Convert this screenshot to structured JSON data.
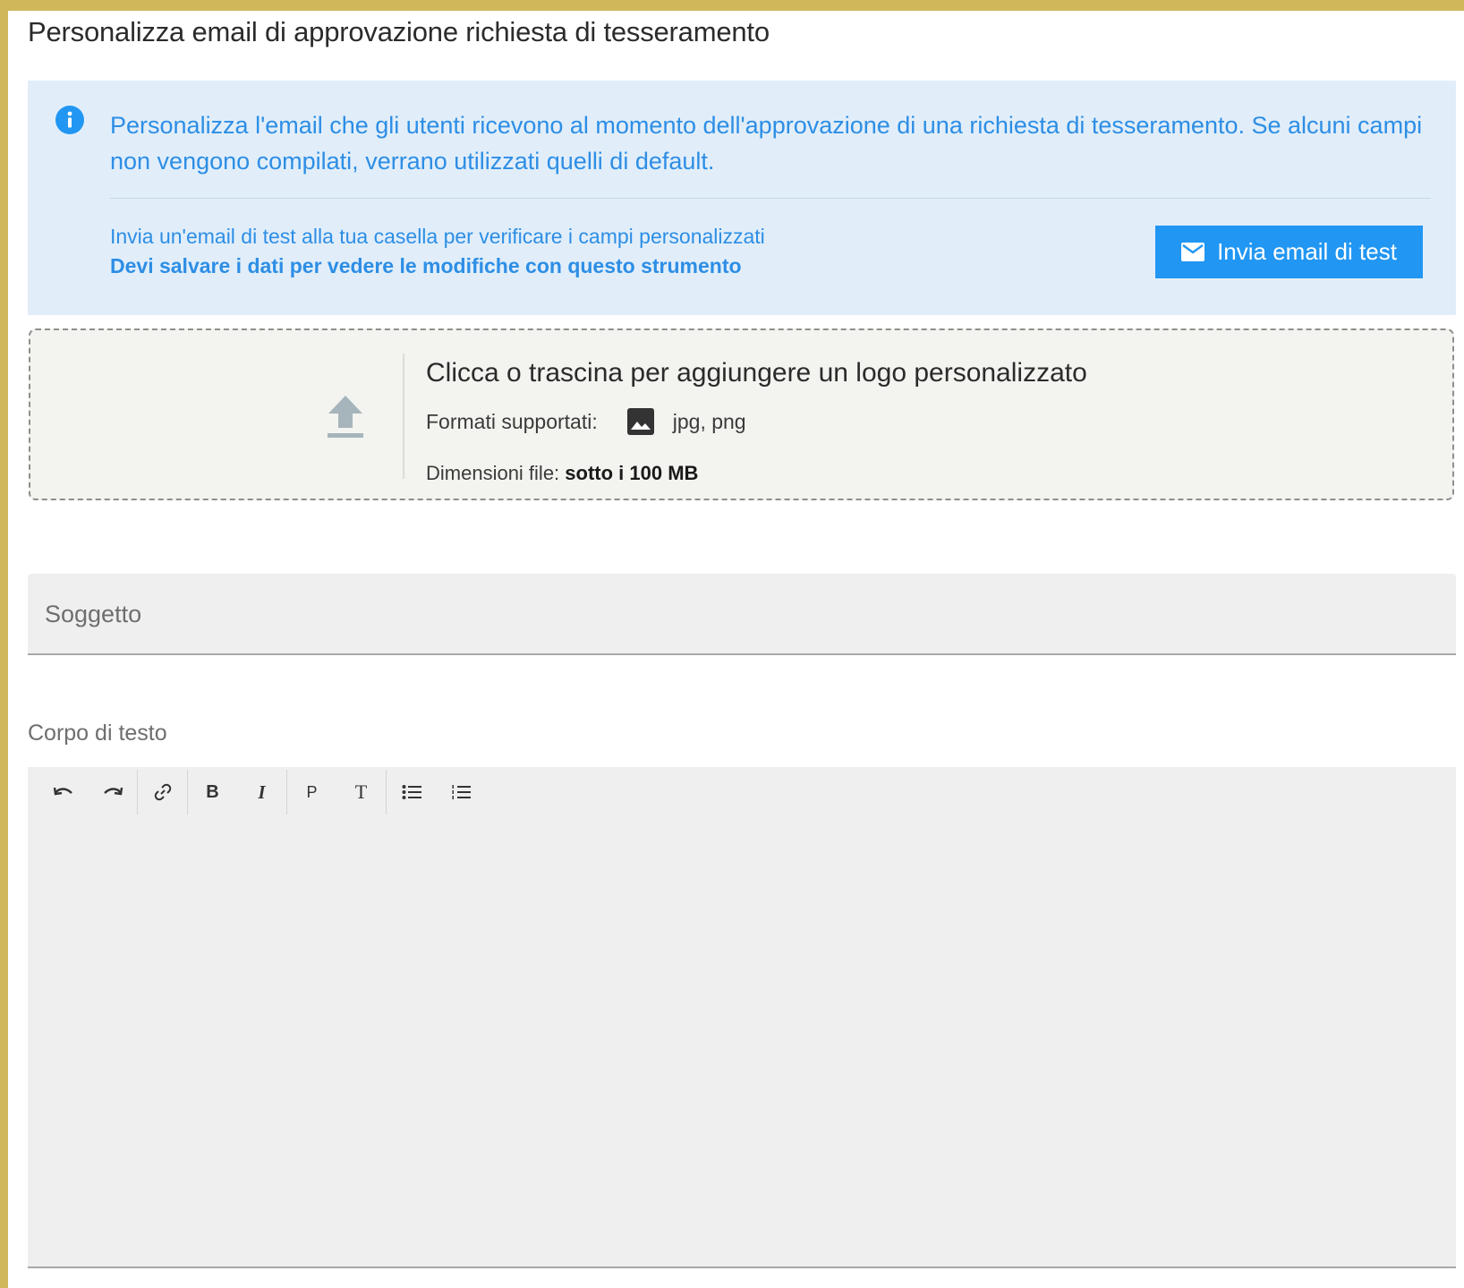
{
  "page": {
    "title": "Personalizza email di approvazione richiesta di tesseramento"
  },
  "info": {
    "icon": "info-icon",
    "text": "Personalizza l'email che gli utenti ricevono al momento dell'approvazione di una richiesta di tesseramento. Se alcuni campi non vengono compilati, verrano utilizzati quelli di default.",
    "test_hint": "Invia un'email di test alla tua casella per verificare i campi personalizzati",
    "test_warning": "Devi salvare i dati per vedere le modifiche con questo strumento",
    "test_button_label": "Invia email di test",
    "test_button_icon": "mail-icon"
  },
  "upload": {
    "icon": "upload-icon",
    "title": "Clicca o trascina per aggiungere un logo personalizzato",
    "formats_label": "Formati supportati:",
    "formats_icon": "image-icon",
    "formats_value": "jpg, png",
    "size_label": "Dimensioni file:",
    "size_value": "sotto i 100 MB"
  },
  "subject": {
    "label": "Soggetto",
    "value": ""
  },
  "body": {
    "label": "Corpo di testo",
    "value": "",
    "toolbar": [
      {
        "name": "undo-icon",
        "label": "↶"
      },
      {
        "name": "redo-icon",
        "label": "↷"
      },
      {
        "name": "link-icon",
        "label": ""
      },
      {
        "name": "bold-icon",
        "label": "B"
      },
      {
        "name": "italic-icon",
        "label": "I"
      },
      {
        "name": "paragraph-icon",
        "label": "P"
      },
      {
        "name": "heading-icon",
        "label": "T"
      },
      {
        "name": "bullet-list-icon",
        "label": ""
      },
      {
        "name": "numbered-list-icon",
        "label": ""
      }
    ]
  },
  "colors": {
    "accent": "#2196f3",
    "info_bg": "#e1eefa",
    "info_text": "#2d8ee5",
    "frame": "#cfb75a"
  }
}
